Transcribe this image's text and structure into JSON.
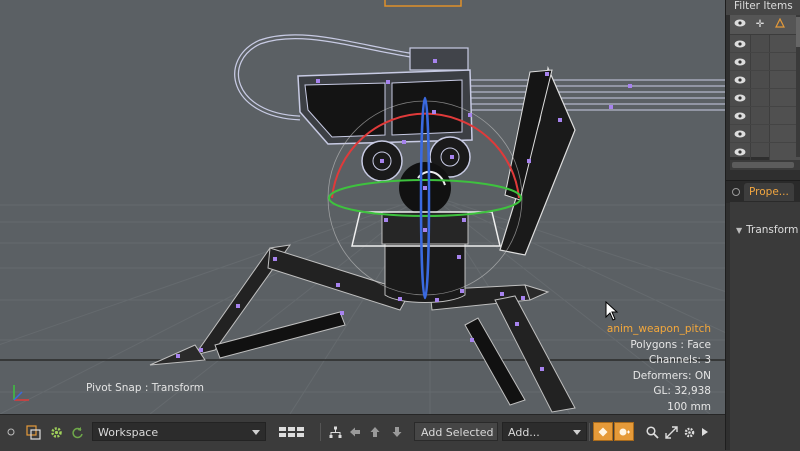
{
  "viewport": {
    "pivot_snap_text": "Pivot Snap : Transform",
    "info": {
      "item_name": "anim_weapon_pitch",
      "polygons": "Polygons : Face",
      "channels": "Channels: 3",
      "deformers": "Deformers: ON",
      "gl": "GL: 32,938",
      "scale": "100 mm"
    },
    "gizmo_colors": {
      "x": "#e03a3a",
      "y": "#3ec23e",
      "z": "#3a6ae0"
    }
  },
  "right_panel": {
    "filter_label": "Filter Items",
    "list_row_count": 8,
    "properties_tab": "Prope...",
    "transform_label": "Transform"
  },
  "toolbar": {
    "workspace_value": "Workspace",
    "add_selected_label": "Add Selected",
    "add_value": "Add...",
    "accent_color": "#e59a39"
  }
}
